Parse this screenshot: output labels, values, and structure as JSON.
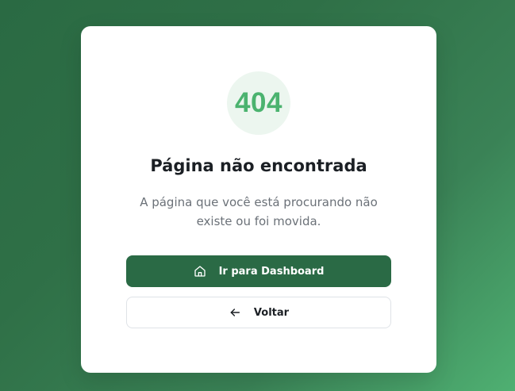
{
  "error": {
    "code": "404",
    "title": "Página não encontrada",
    "description": "A página que você está procurando não existe ou foi movida."
  },
  "actions": {
    "primary_label": "Ir para Dashboard",
    "primary_icon": "home-icon",
    "secondary_label": "Voltar",
    "secondary_icon": "arrow-left-icon"
  },
  "colors": {
    "accent": "#4bb36f",
    "primary_button": "#2a6a45",
    "badge_bg": "#ecf6ef"
  }
}
